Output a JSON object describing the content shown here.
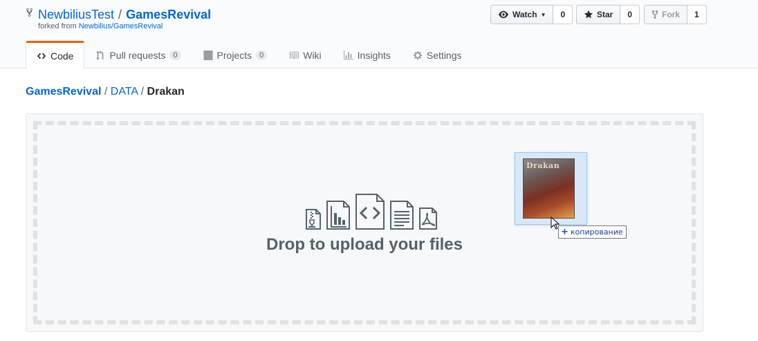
{
  "repo": {
    "owner": "NewbiliusTest",
    "separator": "/",
    "name": "GamesRevival",
    "forked_prefix": "forked from",
    "forked_from": "Newbilius/GamesRevival"
  },
  "actions": {
    "watch_label": "Watch",
    "watch_count": "0",
    "star_label": "Star",
    "star_count": "0",
    "fork_label": "Fork",
    "fork_count": "1"
  },
  "tabs": [
    {
      "label": "Code",
      "icon": "code-icon",
      "selected": true
    },
    {
      "label": "Pull requests",
      "icon": "git-pull-request-icon",
      "count": "0"
    },
    {
      "label": "Projects",
      "icon": "project-icon",
      "count": "0"
    },
    {
      "label": "Wiki",
      "icon": "book-icon"
    },
    {
      "label": "Insights",
      "icon": "graph-icon"
    },
    {
      "label": "Settings",
      "icon": "gear-icon"
    }
  ],
  "breadcrumb": {
    "root": "GamesRevival",
    "sep1": "/",
    "dir": "DATA",
    "sep2": "/",
    "final": "Drakan"
  },
  "dropzone": {
    "text": "Drop to upload your files",
    "icons": [
      "file-zip-icon",
      "graph-file-icon",
      "file-code-icon",
      "file-text-icon",
      "file-pdf-icon"
    ]
  },
  "drag": {
    "cover_title": "Drakan",
    "tooltip_symbol": "+",
    "tooltip": "копирование"
  },
  "colors": {
    "link": "#0366d6",
    "tab_accent": "#e36209",
    "muted": "#586069"
  }
}
